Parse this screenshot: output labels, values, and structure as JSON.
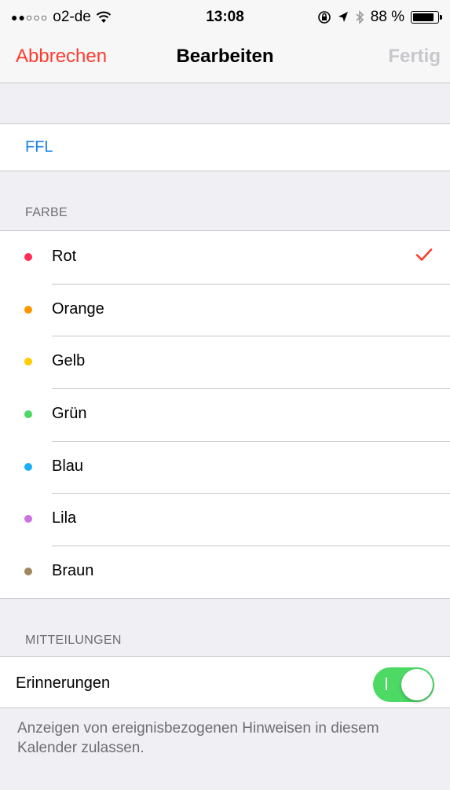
{
  "status_bar": {
    "carrier": "o2-de",
    "time": "13:08",
    "battery": "88 %",
    "battery_level": 0.88
  },
  "nav": {
    "cancel_label": "Abbrechen",
    "title": "Bearbeiten",
    "done_label": "Fertig"
  },
  "calendar_name": "FFL",
  "color_section": {
    "header": "FARBE",
    "selected": "Rot",
    "items": [
      {
        "label": "Rot",
        "color": "#ff2d55"
      },
      {
        "label": "Orange",
        "color": "#ff9500"
      },
      {
        "label": "Gelb",
        "color": "#ffcc00"
      },
      {
        "label": "Grün",
        "color": "#4cd964"
      },
      {
        "label": "Blau",
        "color": "#1badf8"
      },
      {
        "label": "Lila",
        "color": "#cc73e1"
      },
      {
        "label": "Braun",
        "color": "#a2845e"
      }
    ]
  },
  "notifications_section": {
    "header": "MITTEILUNGEN",
    "reminders_label": "Erinnerungen",
    "reminders_on": true,
    "footer": "Anzeigen von ereignisbezogenen Hinweisen in diesem Kalender zulassen."
  },
  "colors": {
    "accent_red": "#ff3b30",
    "link_blue": "#1a82e6",
    "toggle_on": "#4cd964"
  },
  "icons": [
    "signal-dots-icon",
    "wifi-icon",
    "rotation-lock-icon",
    "location-arrow-icon",
    "bluetooth-icon",
    "battery-icon",
    "checkmark-icon"
  ]
}
